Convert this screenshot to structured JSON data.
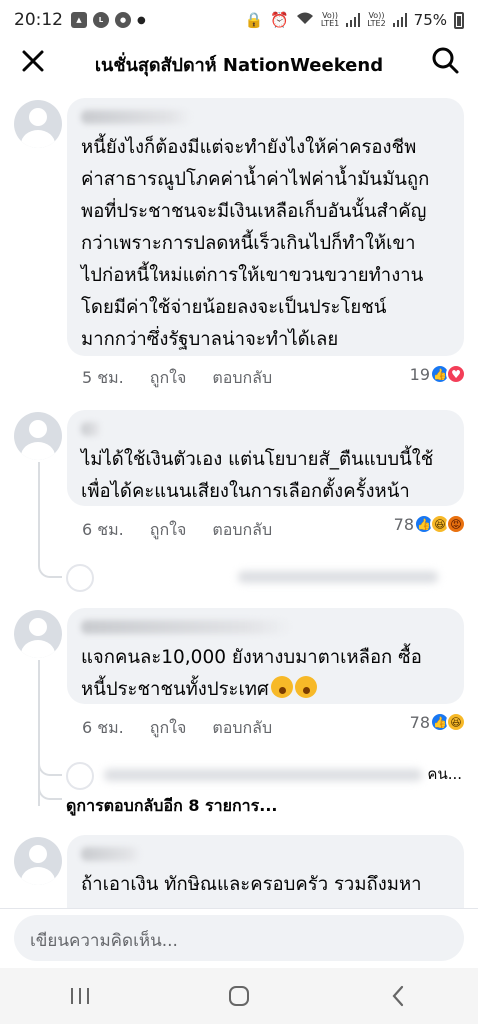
{
  "status": {
    "time": "20:12",
    "battery": "75%",
    "lte1": "Vo))\nLTE1",
    "lte2": "Vo))\nLTE2"
  },
  "header": {
    "title": "เนชั่นสุดสัปดาห์ NationWeekend"
  },
  "comments": [
    {
      "text": "หนี้ยังไงก็ต้องมีแต่จะทำยังไงให้ค่าครองชีพ\nค่าสาธารณูปโภคค่าน้ำค่าไฟค่าน้ำมันมันถูก\nพอที่ประชาชนจะมีเงินเหลือเก็บอันนั้นสำคัญ\nกว่าเพราะการปลดหนี้เร็วเกินไปก็ทำให้เขา\nไปก่อหนี้ใหม่แต่การให้เขาขวนขวายทำงาน\nโดยมีค่าใช้จ่ายน้อยลงจะเป็นประโยชน์\nมากกว่าซึ่งรัฐบาลน่าจะทำได้เลย",
      "time": "5 ชม.",
      "like": "ถูกใจ",
      "reply": "ตอบกลับ",
      "reaction_count": "19"
    },
    {
      "text": "ไม่ได้ใช้เงินตัวเอง แต่นโยบายสั_ตืนแบบนี้ใช้\nเพื่อได้คะแนนเสียงในการเลือกตั้งครั้งหน้า",
      "time": "6 ชม.",
      "like": "ถูกใจ",
      "reply": "ตอบกลับ",
      "reaction_count": "78"
    },
    {
      "text": "แจกคนละ10,000 ยังหางบมาตาเหลือก ซื้อ\nหนี้ประชาชนทั้งประเทศ",
      "time": "6 ชม.",
      "like": "ถูกใจ",
      "reply": "ตอบกลับ",
      "reaction_count": "78",
      "reply_tail": "คน...",
      "more_replies": "ดูการตอบกลับอีก 8 รายการ..."
    },
    {
      "text": "ถ้าเอาเงิน ทักษิณและครอบครัว รวมถึงมหา"
    }
  ],
  "composer": {
    "placeholder": "เขียนความคิดเห็น..."
  }
}
